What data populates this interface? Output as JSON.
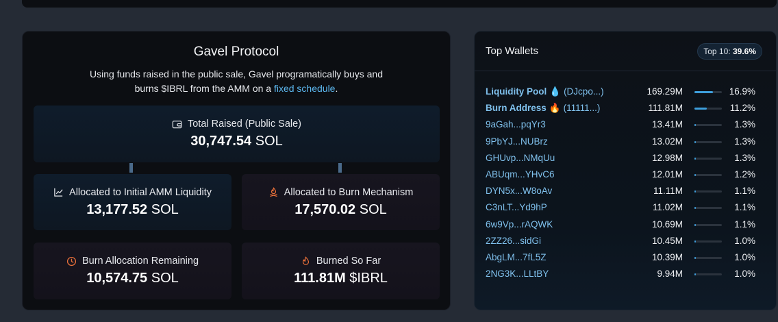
{
  "gavel": {
    "title": "Gavel Protocol",
    "description": "Using funds raised in the public sale, Gavel programatically buys and burns $IBRL from the AMM on a",
    "description_link": "fixed schedule",
    "description_end": ".",
    "total_raised": {
      "label": "Total Raised (Public Sale)",
      "value": "30,747.54",
      "unit": "SOL",
      "icon": "wallet-icon"
    },
    "amm_liquidity": {
      "label": "Allocated to Initial AMM Liquidity",
      "value": "13,177.52",
      "unit": "SOL",
      "icon": "chart-line-icon"
    },
    "burn_mechanism": {
      "label": "Allocated to Burn Mechanism",
      "value": "17,570.02",
      "unit": "SOL",
      "icon": "campfire-icon"
    },
    "burn_remaining": {
      "label": "Burn Allocation Remaining",
      "value": "10,574.75",
      "unit": "SOL",
      "icon": "clock-icon"
    },
    "burned_so_far": {
      "label": "Burned So Far",
      "value": "111.81M",
      "unit": "$IBRL",
      "icon": "flame-icon"
    }
  },
  "wallets": {
    "title": "Top Wallets",
    "badge_label": "Top 10:",
    "badge_value": "39.6%",
    "rows": [
      {
        "name": "Liquidity Pool",
        "emoji": "💧",
        "tag": "(DJcpo...)",
        "amount": "169.29M",
        "percent": "16.9%",
        "share": 16.9,
        "bold": true
      },
      {
        "name": "Burn Address",
        "emoji": "🔥",
        "tag": "(11111...)",
        "amount": "111.81M",
        "percent": "11.2%",
        "share": 11.2,
        "bold": true
      },
      {
        "name": "9aGah...pqYr3",
        "amount": "13.41M",
        "percent": "1.3%",
        "share": 1.3
      },
      {
        "name": "9PbYJ...NUBrz",
        "amount": "13.02M",
        "percent": "1.3%",
        "share": 1.3
      },
      {
        "name": "GHUvp...NMqUu",
        "amount": "12.98M",
        "percent": "1.3%",
        "share": 1.3
      },
      {
        "name": "ABUqm...YHvC6",
        "amount": "12.01M",
        "percent": "1.2%",
        "share": 1.2
      },
      {
        "name": "DYN5x...W8oAv",
        "amount": "11.11M",
        "percent": "1.1%",
        "share": 1.1
      },
      {
        "name": "C3nLT...Yd9hP",
        "amount": "11.02M",
        "percent": "1.1%",
        "share": 1.1
      },
      {
        "name": "6w9Vp...rAQWK",
        "amount": "10.69M",
        "percent": "1.1%",
        "share": 1.1
      },
      {
        "name": "2ZZ26...sidGi",
        "amount": "10.45M",
        "percent": "1.0%",
        "share": 1.0
      },
      {
        "name": "AbgLM...7fL5Z",
        "amount": "10.39M",
        "percent": "1.0%",
        "share": 1.0
      },
      {
        "name": "2NG3K...LLtBY",
        "amount": "9.94M",
        "percent": "1.0%",
        "share": 1.0
      }
    ]
  },
  "colors": {
    "accent_blue": "#3e9fdc",
    "link_blue": "#7fc0ec",
    "icon_orange": "#e8703a"
  }
}
